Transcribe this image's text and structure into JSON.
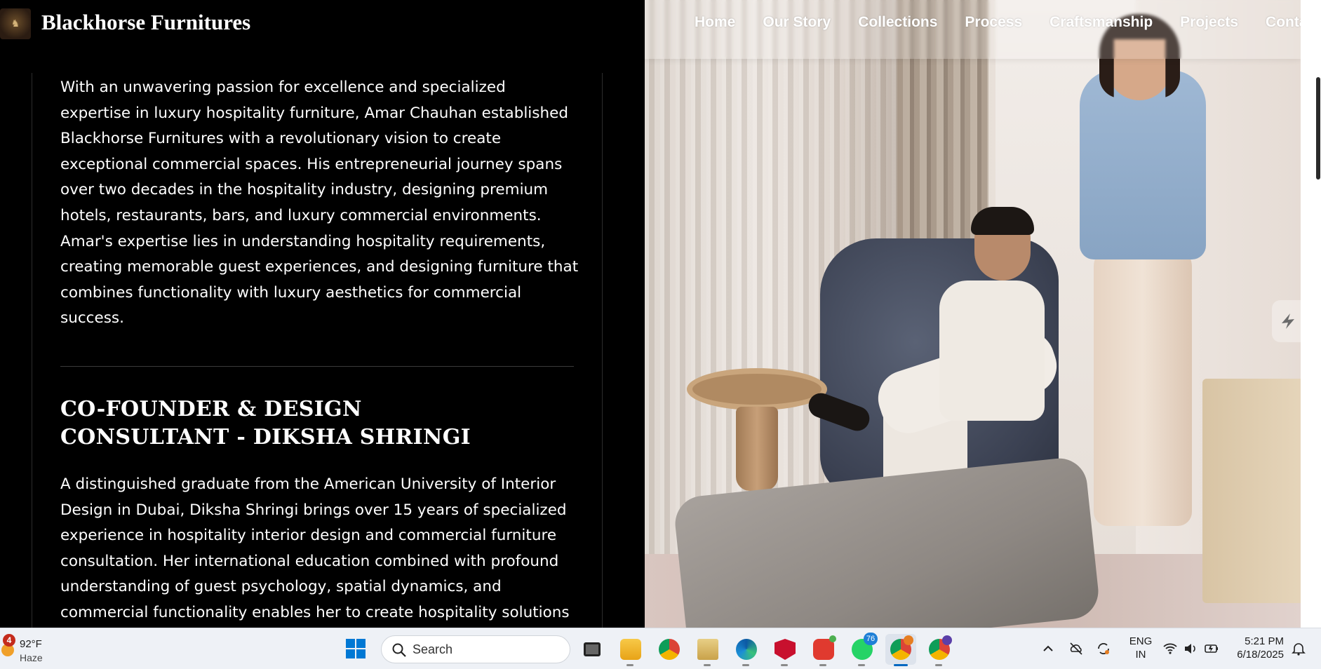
{
  "header": {
    "brand": "Blackhorse Furnitures",
    "nav": [
      "Home",
      "Our Story",
      "Collections",
      "Process",
      "Craftsmanship",
      "Projects",
      "Contact"
    ]
  },
  "content": {
    "para1": "With an unwavering passion for excellence and specialized expertise in luxury hospitality furniture, Amar Chauhan established Blackhorse Furnitures with a revolutionary vision to create exceptional commercial spaces. His entrepreneurial journey spans over two decades in the hospitality industry, designing premium hotels, restaurants, bars, and luxury commercial environments. Amar's expertise lies in understanding hospitality requirements, creating memorable guest experiences, and designing furniture that combines functionality with luxury aesthetics for commercial success.",
    "heading": "CO-FOUNDER & DESIGN CONSULTANT - DIKSHA SHRINGI",
    "para2": "A distinguished graduate from the American University of Interior Design in Dubai, Diksha Shringi brings over 15 years of specialized experience in hospitality interior design and commercial furniture consultation. Her international education combined with profound understanding of guest psychology, spatial dynamics, and commercial functionality enables her to create hospitality solutions"
  },
  "taskbar": {
    "weather": {
      "badge": "4",
      "temp": "92°F",
      "condition": "Haze"
    },
    "search_placeholder": "Search",
    "apps": [
      {
        "name": "task-view",
        "color": "#2b2b2b"
      },
      {
        "name": "file-explorer",
        "color": "#f3b628"
      },
      {
        "name": "chrome",
        "color": "#dd4b39"
      },
      {
        "name": "archive-manager",
        "color": "#d9b45a"
      },
      {
        "name": "edge",
        "color": "#1b8ed6"
      },
      {
        "name": "mcafee",
        "color": "#c8102e"
      },
      {
        "name": "wps-office",
        "color": "#e03a2f",
        "badge": ""
      },
      {
        "name": "whatsapp",
        "color": "#25d366",
        "badge": "76"
      },
      {
        "name": "chrome-profile-1",
        "color": "#dd4b39",
        "badge": ""
      },
      {
        "name": "chrome-profile-2",
        "color": "#dd4b39",
        "badge": ""
      }
    ],
    "lang_line1": "ENG",
    "lang_line2": "IN",
    "time": "5:21 PM",
    "date": "6/18/2025"
  },
  "colors": {
    "page_bg": "#000000",
    "text": "#ffffff",
    "taskbar_bg": "#eef1f6",
    "accent": "#0067c0"
  }
}
